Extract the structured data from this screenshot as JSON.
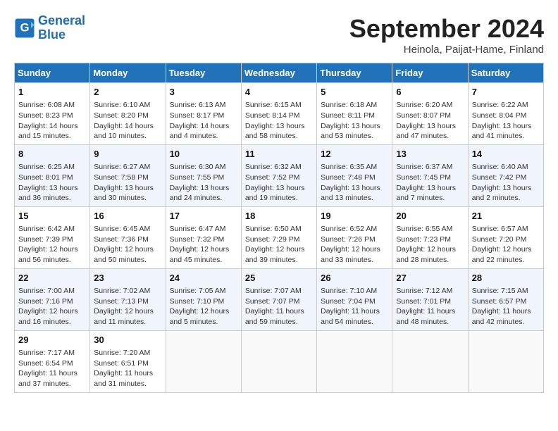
{
  "header": {
    "logo_line1": "General",
    "logo_line2": "Blue",
    "month": "September 2024",
    "location": "Heinola, Paijat-Hame, Finland"
  },
  "columns": [
    "Sunday",
    "Monday",
    "Tuesday",
    "Wednesday",
    "Thursday",
    "Friday",
    "Saturday"
  ],
  "weeks": [
    [
      {
        "day": "1",
        "sunrise": "Sunrise: 6:08 AM",
        "sunset": "Sunset: 8:23 PM",
        "daylight": "Daylight: 14 hours and 15 minutes."
      },
      {
        "day": "2",
        "sunrise": "Sunrise: 6:10 AM",
        "sunset": "Sunset: 8:20 PM",
        "daylight": "Daylight: 14 hours and 10 minutes."
      },
      {
        "day": "3",
        "sunrise": "Sunrise: 6:13 AM",
        "sunset": "Sunset: 8:17 PM",
        "daylight": "Daylight: 14 hours and 4 minutes."
      },
      {
        "day": "4",
        "sunrise": "Sunrise: 6:15 AM",
        "sunset": "Sunset: 8:14 PM",
        "daylight": "Daylight: 13 hours and 58 minutes."
      },
      {
        "day": "5",
        "sunrise": "Sunrise: 6:18 AM",
        "sunset": "Sunset: 8:11 PM",
        "daylight": "Daylight: 13 hours and 53 minutes."
      },
      {
        "day": "6",
        "sunrise": "Sunrise: 6:20 AM",
        "sunset": "Sunset: 8:07 PM",
        "daylight": "Daylight: 13 hours and 47 minutes."
      },
      {
        "day": "7",
        "sunrise": "Sunrise: 6:22 AM",
        "sunset": "Sunset: 8:04 PM",
        "daylight": "Daylight: 13 hours and 41 minutes."
      }
    ],
    [
      {
        "day": "8",
        "sunrise": "Sunrise: 6:25 AM",
        "sunset": "Sunset: 8:01 PM",
        "daylight": "Daylight: 13 hours and 36 minutes."
      },
      {
        "day": "9",
        "sunrise": "Sunrise: 6:27 AM",
        "sunset": "Sunset: 7:58 PM",
        "daylight": "Daylight: 13 hours and 30 minutes."
      },
      {
        "day": "10",
        "sunrise": "Sunrise: 6:30 AM",
        "sunset": "Sunset: 7:55 PM",
        "daylight": "Daylight: 13 hours and 24 minutes."
      },
      {
        "day": "11",
        "sunrise": "Sunrise: 6:32 AM",
        "sunset": "Sunset: 7:52 PM",
        "daylight": "Daylight: 13 hours and 19 minutes."
      },
      {
        "day": "12",
        "sunrise": "Sunrise: 6:35 AM",
        "sunset": "Sunset: 7:48 PM",
        "daylight": "Daylight: 13 hours and 13 minutes."
      },
      {
        "day": "13",
        "sunrise": "Sunrise: 6:37 AM",
        "sunset": "Sunset: 7:45 PM",
        "daylight": "Daylight: 13 hours and 7 minutes."
      },
      {
        "day": "14",
        "sunrise": "Sunrise: 6:40 AM",
        "sunset": "Sunset: 7:42 PM",
        "daylight": "Daylight: 13 hours and 2 minutes."
      }
    ],
    [
      {
        "day": "15",
        "sunrise": "Sunrise: 6:42 AM",
        "sunset": "Sunset: 7:39 PM",
        "daylight": "Daylight: 12 hours and 56 minutes."
      },
      {
        "day": "16",
        "sunrise": "Sunrise: 6:45 AM",
        "sunset": "Sunset: 7:36 PM",
        "daylight": "Daylight: 12 hours and 50 minutes."
      },
      {
        "day": "17",
        "sunrise": "Sunrise: 6:47 AM",
        "sunset": "Sunset: 7:32 PM",
        "daylight": "Daylight: 12 hours and 45 minutes."
      },
      {
        "day": "18",
        "sunrise": "Sunrise: 6:50 AM",
        "sunset": "Sunset: 7:29 PM",
        "daylight": "Daylight: 12 hours and 39 minutes."
      },
      {
        "day": "19",
        "sunrise": "Sunrise: 6:52 AM",
        "sunset": "Sunset: 7:26 PM",
        "daylight": "Daylight: 12 hours and 33 minutes."
      },
      {
        "day": "20",
        "sunrise": "Sunrise: 6:55 AM",
        "sunset": "Sunset: 7:23 PM",
        "daylight": "Daylight: 12 hours and 28 minutes."
      },
      {
        "day": "21",
        "sunrise": "Sunrise: 6:57 AM",
        "sunset": "Sunset: 7:20 PM",
        "daylight": "Daylight: 12 hours and 22 minutes."
      }
    ],
    [
      {
        "day": "22",
        "sunrise": "Sunrise: 7:00 AM",
        "sunset": "Sunset: 7:16 PM",
        "daylight": "Daylight: 12 hours and 16 minutes."
      },
      {
        "day": "23",
        "sunrise": "Sunrise: 7:02 AM",
        "sunset": "Sunset: 7:13 PM",
        "daylight": "Daylight: 12 hours and 11 minutes."
      },
      {
        "day": "24",
        "sunrise": "Sunrise: 7:05 AM",
        "sunset": "Sunset: 7:10 PM",
        "daylight": "Daylight: 12 hours and 5 minutes."
      },
      {
        "day": "25",
        "sunrise": "Sunrise: 7:07 AM",
        "sunset": "Sunset: 7:07 PM",
        "daylight": "Daylight: 11 hours and 59 minutes."
      },
      {
        "day": "26",
        "sunrise": "Sunrise: 7:10 AM",
        "sunset": "Sunset: 7:04 PM",
        "daylight": "Daylight: 11 hours and 54 minutes."
      },
      {
        "day": "27",
        "sunrise": "Sunrise: 7:12 AM",
        "sunset": "Sunset: 7:01 PM",
        "daylight": "Daylight: 11 hours and 48 minutes."
      },
      {
        "day": "28",
        "sunrise": "Sunrise: 7:15 AM",
        "sunset": "Sunset: 6:57 PM",
        "daylight": "Daylight: 11 hours and 42 minutes."
      }
    ],
    [
      {
        "day": "29",
        "sunrise": "Sunrise: 7:17 AM",
        "sunset": "Sunset: 6:54 PM",
        "daylight": "Daylight: 11 hours and 37 minutes."
      },
      {
        "day": "30",
        "sunrise": "Sunrise: 7:20 AM",
        "sunset": "Sunset: 6:51 PM",
        "daylight": "Daylight: 11 hours and 31 minutes."
      },
      null,
      null,
      null,
      null,
      null
    ]
  ]
}
